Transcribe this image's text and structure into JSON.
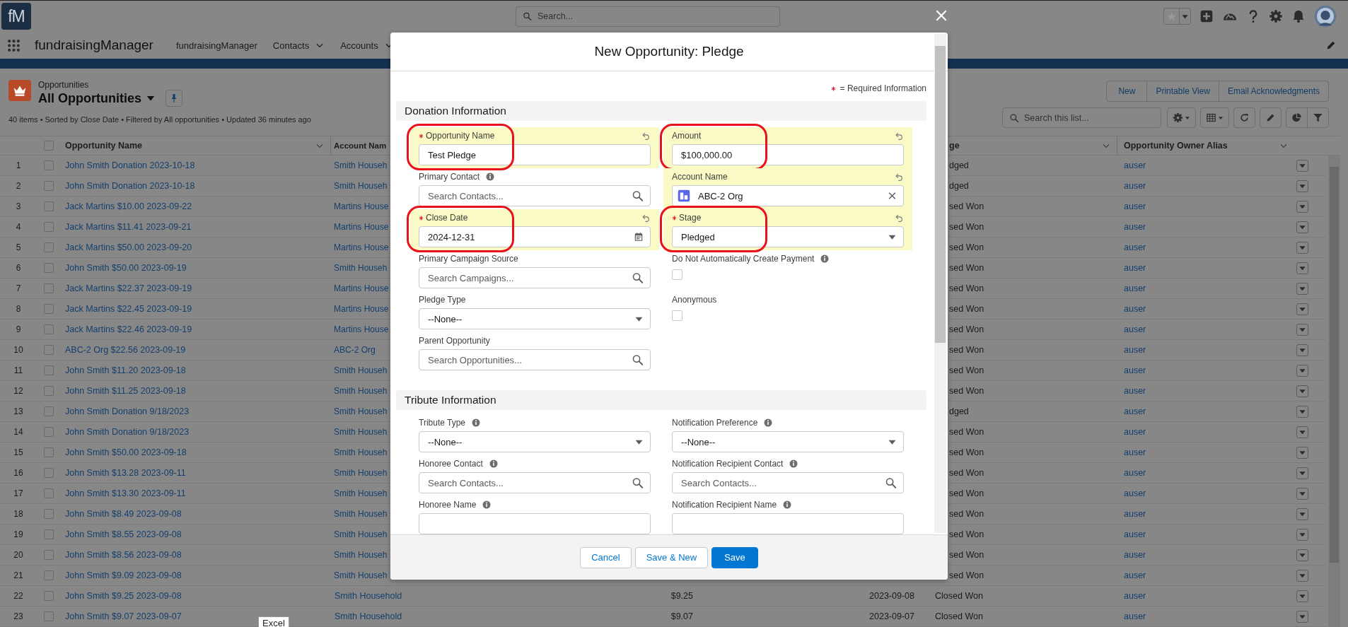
{
  "header": {
    "logo": "fM",
    "search_placeholder": "Search..."
  },
  "nav": {
    "app_name": "fundraisingManager",
    "tabs": [
      {
        "label": "fundraisingManager",
        "menu": false
      },
      {
        "label": "Contacts",
        "menu": true
      },
      {
        "label": "Accounts",
        "menu": true
      }
    ]
  },
  "list": {
    "object": "Opportunities",
    "view": "All Opportunities",
    "summary": "40 items • Sorted by Close Date • Filtered by All opportunities • Updated 36 minutes ago",
    "actions": [
      "New",
      "Printable View",
      "Email Acknowledgments"
    ],
    "search_placeholder": "Search this list...",
    "all_checked": false,
    "columns": [
      {
        "label": "Opportunity Name",
        "menu": true
      },
      {
        "label": "Account Nam",
        "menu": false
      },
      {
        "label": "ge",
        "menu": true
      },
      {
        "label": "Opportunity Owner Alias",
        "menu": true
      }
    ],
    "rows": [
      {
        "num": "1",
        "checked": false,
        "name": "John Smith Donation 2023-10-18",
        "account": "Smith Househ",
        "stage": "dged",
        "alias": "auser"
      },
      {
        "num": "2",
        "checked": false,
        "name": "John Smith Donation 2023-10-18",
        "account": "Smith Househ",
        "stage": "dged",
        "alias": "auser"
      },
      {
        "num": "3",
        "checked": false,
        "name": "Jack Martins $10.00 2023-09-22",
        "account": "Martins House",
        "stage": "sed Won",
        "alias": "auser"
      },
      {
        "num": "4",
        "checked": false,
        "name": "Jack Martins $11.41 2023-09-21",
        "account": "Martins House",
        "stage": "sed Won",
        "alias": "auser"
      },
      {
        "num": "5",
        "checked": false,
        "name": "Jack Martins $50.00 2023-09-20",
        "account": "Martins House",
        "stage": "sed Won",
        "alias": "auser"
      },
      {
        "num": "6",
        "checked": false,
        "name": "John Smith $50.00 2023-09-19",
        "account": "Smith Househ",
        "stage": "sed Won",
        "alias": "auser"
      },
      {
        "num": "7",
        "checked": false,
        "name": "Jack Martins $22.37 2023-09-19",
        "account": "Martins House",
        "stage": "sed Won",
        "alias": "auser"
      },
      {
        "num": "8",
        "checked": false,
        "name": "Jack Martins $22.45 2023-09-19",
        "account": "Martins House",
        "stage": "sed Won",
        "alias": "auser"
      },
      {
        "num": "9",
        "checked": false,
        "name": "Jack Martins $22.46 2023-09-19",
        "account": "Martins House",
        "stage": "sed Won",
        "alias": "auser"
      },
      {
        "num": "10",
        "checked": false,
        "name": "ABC-2 Org $22.56 2023-09-19",
        "account": "ABC-2 Org",
        "stage": "sed Won",
        "alias": "auser"
      },
      {
        "num": "11",
        "checked": false,
        "name": "John Smith $11.20 2023-09-18",
        "account": "Smith Househ",
        "stage": "sed Won",
        "alias": "auser"
      },
      {
        "num": "12",
        "checked": false,
        "name": "John Smith $11.25 2023-09-18",
        "account": "Smith Househ",
        "stage": "sed Won",
        "alias": "auser"
      },
      {
        "num": "13",
        "checked": false,
        "name": "John Smith Donation 9/18/2023",
        "account": "Smith Househ",
        "stage": "dged",
        "alias": "auser"
      },
      {
        "num": "14",
        "checked": false,
        "name": "John Smith Donation 9/18/2023",
        "account": "Smith Househ",
        "stage": "sed Won",
        "alias": "auser"
      },
      {
        "num": "15",
        "checked": false,
        "name": "John Smith $50.00 2023-09-18",
        "account": "Smith Househ",
        "stage": "sed Won",
        "alias": "auser"
      },
      {
        "num": "16",
        "checked": false,
        "name": "John Smith $13.28 2023-09-11",
        "account": "Smith Househ",
        "stage": "sed Won",
        "alias": "auser"
      },
      {
        "num": "17",
        "checked": false,
        "name": "John Smith $13.30 2023-09-11",
        "account": "Smith Househ",
        "stage": "sed Won",
        "alias": "auser"
      },
      {
        "num": "18",
        "checked": false,
        "name": "John Smith $8.49 2023-09-08",
        "account": "Smith Househ",
        "stage": "sed Won",
        "alias": "auser"
      },
      {
        "num": "19",
        "checked": false,
        "name": "John Smith $8.55 2023-09-08",
        "account": "Smith Househ",
        "stage": "sed Won",
        "alias": "auser"
      },
      {
        "num": "20",
        "checked": false,
        "name": "John Smith $8.56 2023-09-08",
        "account": "Smith Househ",
        "stage": "sed Won",
        "alias": "auser"
      },
      {
        "num": "21",
        "checked": false,
        "name": "John Smith $9.09 2023-09-08",
        "account": "Smith Househ",
        "stage": "sed Won",
        "alias": "auser"
      },
      {
        "num": "22",
        "checked": false,
        "name": "John Smith $9.25 2023-09-08",
        "account": "Smith Household",
        "amount": "$9.25",
        "close_date": "2023-09-08",
        "stage": "Closed Won",
        "alias": "auser"
      },
      {
        "num": "23",
        "checked": false,
        "name": "John Smith $9.07 2023-09-07",
        "account": "Smith Household",
        "amount": "$9.07",
        "close_date": "2023-09-07",
        "stage": "Closed Won",
        "alias": "auser"
      }
    ]
  },
  "modal": {
    "title": "New Opportunity: Pledge",
    "required_note": "= Required Information",
    "sections": [
      {
        "title": "Donation Information",
        "fields": [
          {
            "label": "Opportunity Name",
            "kind": "text",
            "value": "Test Pledge",
            "required": true,
            "info": false,
            "highlighted": true,
            "circled": true
          },
          {
            "label": "Amount",
            "kind": "text",
            "value": "$100,000.00",
            "required": false,
            "info": false,
            "highlighted": true,
            "circled": true
          },
          {
            "label": "Primary Contact",
            "kind": "lookup",
            "placeholder": "Search Contacts...",
            "required": false,
            "info": true,
            "highlighted": false,
            "circled": false
          },
          {
            "label": "Account Name",
            "kind": "lookup_selected",
            "value": "ABC-2 Org",
            "required": false,
            "info": false,
            "highlighted": true,
            "circled": false
          },
          {
            "label": "Close Date",
            "kind": "date",
            "value": "2024-12-31",
            "required": true,
            "info": false,
            "highlighted": true,
            "circled": true
          },
          {
            "label": "Stage",
            "kind": "select",
            "value": "Pledged",
            "required": true,
            "info": false,
            "highlighted": true,
            "circled": true
          },
          {
            "label": "Primary Campaign Source",
            "kind": "lookup",
            "placeholder": "Search Campaigns...",
            "required": false,
            "info": false,
            "highlighted": false,
            "circled": false
          },
          {
            "label": "Do Not Automatically Create Payment",
            "kind": "checkbox",
            "checked": false,
            "required": false,
            "info": true,
            "highlighted": false,
            "circled": false
          },
          {
            "label": "Pledge Type",
            "kind": "select",
            "value": "--None--",
            "required": false,
            "info": false,
            "highlighted": false,
            "circled": false
          },
          {
            "label": "Anonymous",
            "kind": "checkbox",
            "checked": false,
            "required": false,
            "info": false,
            "highlighted": false,
            "circled": false
          },
          {
            "label": "Parent Opportunity",
            "kind": "lookup",
            "placeholder": "Search Opportunities...",
            "required": false,
            "info": false,
            "highlighted": false,
            "circled": false
          }
        ]
      },
      {
        "title": "Tribute Information",
        "fields": [
          {
            "label": "Tribute Type",
            "kind": "select",
            "value": "--None--",
            "required": false,
            "info": true,
            "highlighted": false,
            "circled": false
          },
          {
            "label": "Notification Preference",
            "kind": "select",
            "value": "--None--",
            "required": false,
            "info": true,
            "highlighted": false,
            "circled": false
          },
          {
            "label": "Honoree Contact",
            "kind": "lookup",
            "placeholder": "Search Contacts...",
            "required": false,
            "info": true,
            "highlighted": false,
            "circled": false
          },
          {
            "label": "Notification Recipient Contact",
            "kind": "lookup",
            "placeholder": "Search Contacts...",
            "required": false,
            "info": true,
            "highlighted": false,
            "circled": false
          },
          {
            "label": "Honoree Name",
            "kind": "text",
            "required": false,
            "info": true,
            "highlighted": false,
            "circled": false
          },
          {
            "label": "Notification Recipient Name",
            "kind": "text",
            "required": false,
            "info": true,
            "highlighted": false,
            "circled": false
          }
        ]
      }
    ],
    "buttons": [
      {
        "label": "Cancel",
        "primary": false
      },
      {
        "label": "Save & New",
        "primary": false
      },
      {
        "label": "Save",
        "primary": true
      }
    ]
  },
  "tooltip": "Excel"
}
